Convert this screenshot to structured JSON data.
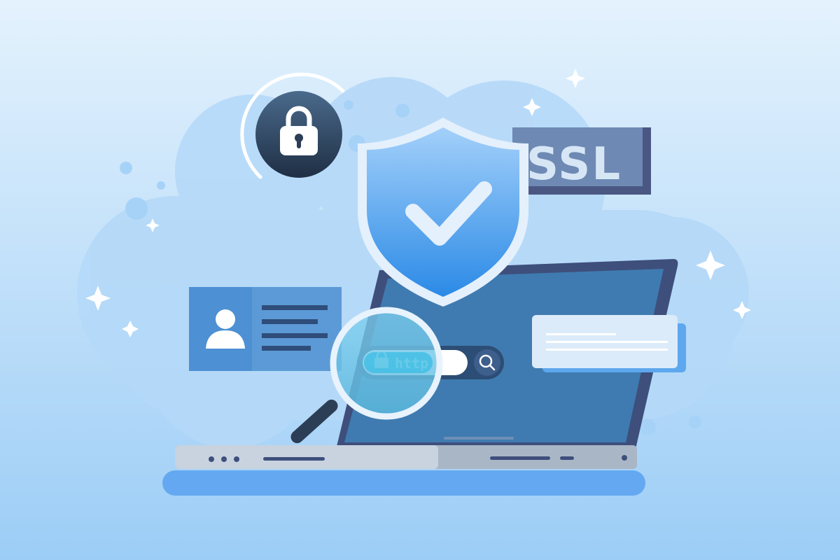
{
  "illustration": {
    "ssl_badge": {
      "label": "SSL"
    },
    "address_bar": {
      "scheme_text": "http",
      "lock_icon": "lock-icon",
      "search_icon": "search-icon"
    },
    "padlock_badge": {
      "icon": "padlock-icon"
    },
    "shield": {
      "icon": "checkmark-icon"
    },
    "profile_card": {
      "icon": "user-icon"
    },
    "magnifier": {
      "icon": "magnifying-glass-icon"
    },
    "info_card": {
      "icon": "text-lines-icon"
    }
  },
  "colors": {
    "background_top": "#e4f2fd",
    "background_bottom": "#9ccdf6",
    "cloud": "#b7dbf9",
    "laptop_frame": "#3e4f7c",
    "laptop_screen": "#3f7bb0",
    "shield_fill": "#4199ec",
    "ssl_badge_bg": "#4b5783",
    "padlock_bg": "#2c3e55",
    "profile_card": "#5b9ad6",
    "keyboard_base": "#c8d3df"
  }
}
